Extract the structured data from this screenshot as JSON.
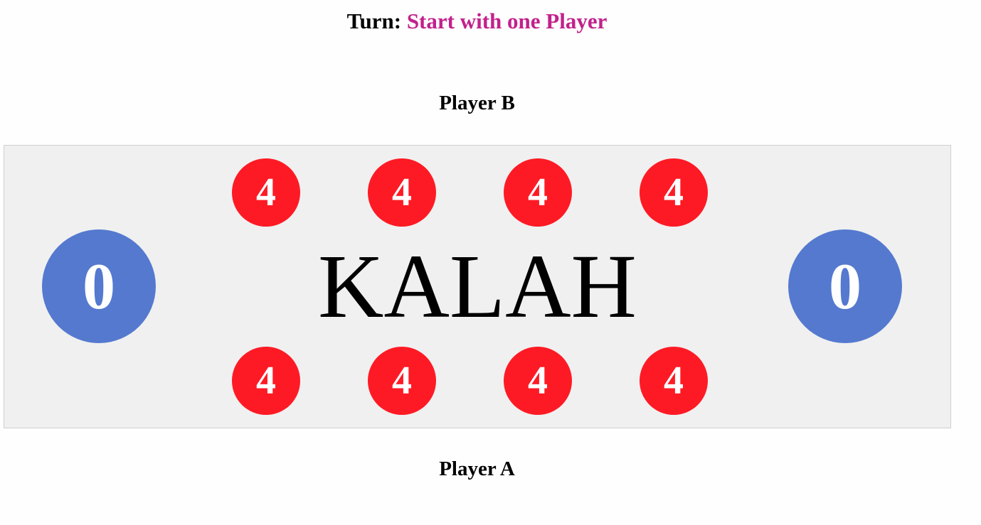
{
  "turn": {
    "label": "Turn:",
    "value": "Start with one Player"
  },
  "players": {
    "top_label": "Player B",
    "bottom_label": "Player A"
  },
  "board": {
    "title": "KALAH",
    "stores": {
      "left": "0",
      "right": "0"
    },
    "top_row": [
      "4",
      "4",
      "4",
      "4"
    ],
    "bottom_row": [
      "4",
      "4",
      "4",
      "4"
    ]
  },
  "colors": {
    "turn_value": "#c2218c",
    "store": "#5479cf",
    "pit": "#fe1a24",
    "board_background": "#f0f0f0"
  }
}
